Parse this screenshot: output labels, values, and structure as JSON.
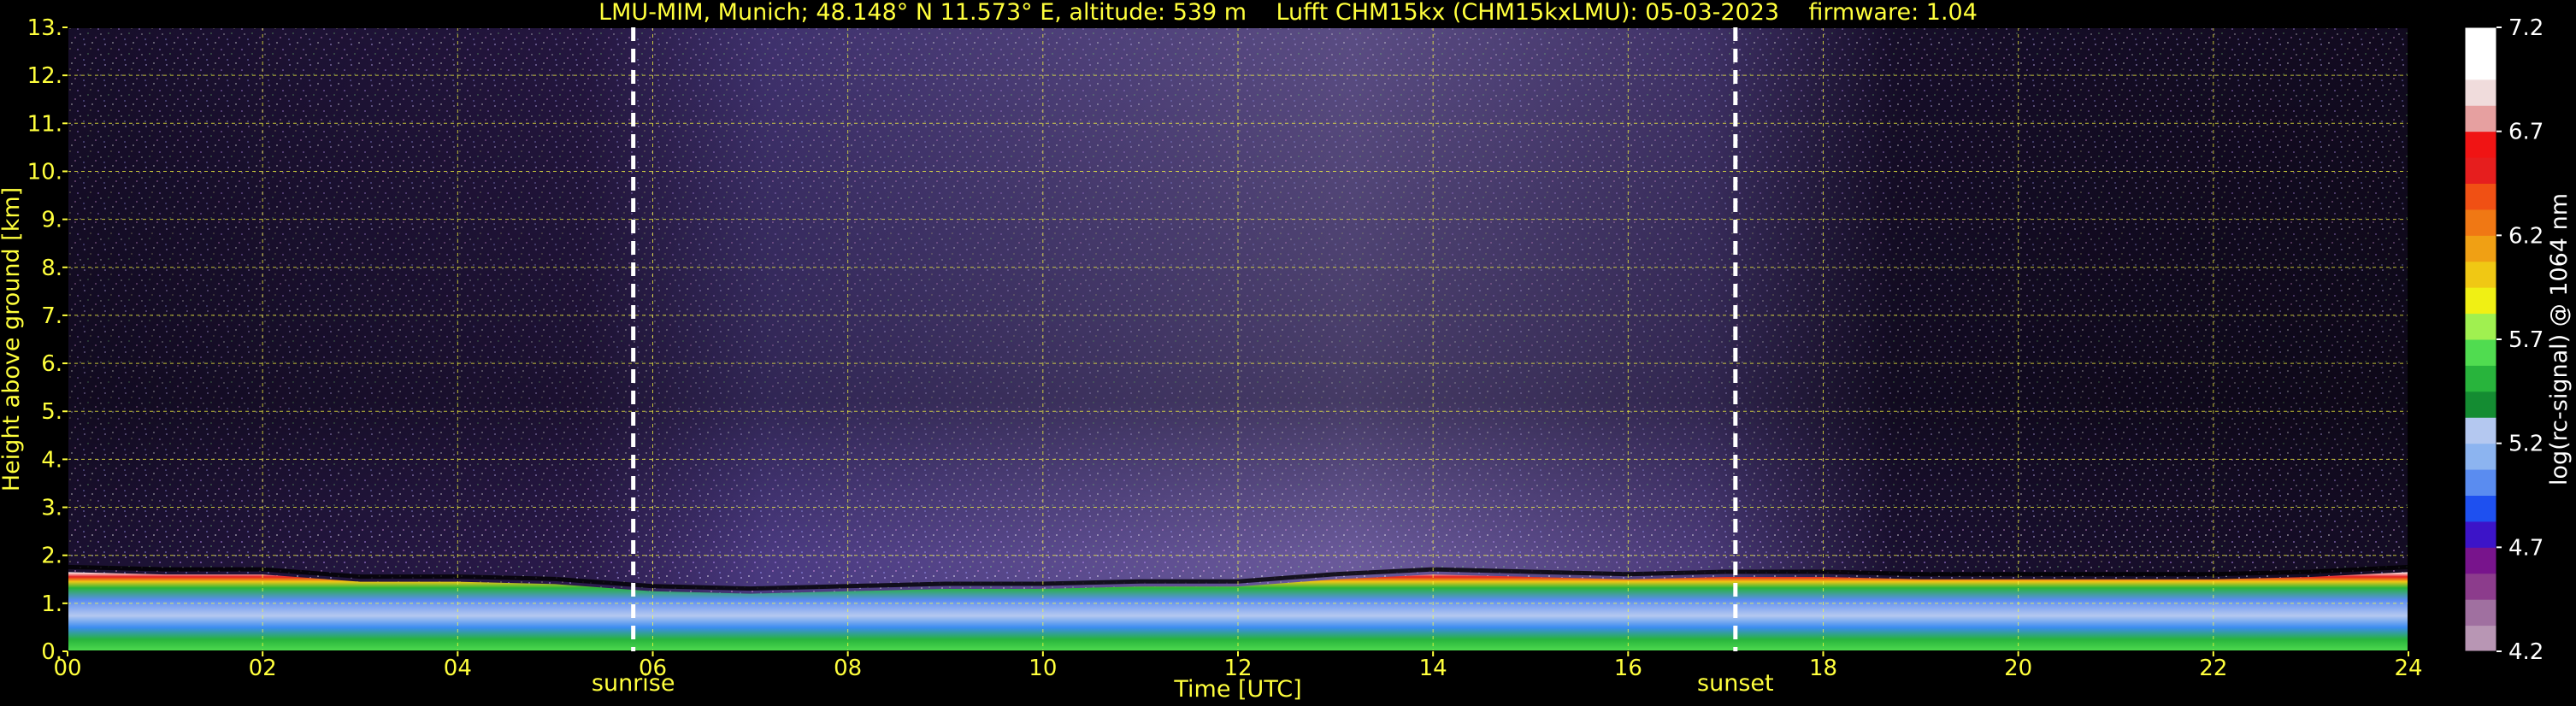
{
  "chart_data": {
    "type": "heatmap",
    "title": "LMU-MIM, Munich; 48.148° N 11.573° E, altitude: 539 m    Lufft CHM15kx (CHM15kxLMU): 05-03-2023    firmware: 1.04",
    "xlabel": "Time [UTC]",
    "ylabel": "Height above ground [km]",
    "xlim": [
      0,
      24
    ],
    "ylim": [
      0,
      13
    ],
    "x_ticks": [
      "00",
      "02",
      "04",
      "06",
      "08",
      "10",
      "12",
      "14",
      "16",
      "18",
      "20",
      "22",
      "24"
    ],
    "y_ticks": [
      "0.",
      "1.",
      "2.",
      "3.",
      "4.",
      "5.",
      "6.",
      "7.",
      "8.",
      "9.",
      "10.",
      "11.",
      "12.",
      "13."
    ],
    "grid": true,
    "events": [
      {
        "label": "sunrise",
        "time": 5.8
      },
      {
        "label": "sunset",
        "time": 17.1
      }
    ],
    "colorbar": {
      "label": "log(rc-signal) @ 1064 nm",
      "range": [
        4.2,
        7.2
      ],
      "ticks": [
        "4.2",
        "4.7",
        "5.2",
        "5.7",
        "6.2",
        "6.7",
        "7.2"
      ],
      "colors": [
        "#b896b4",
        "#a070a0",
        "#8c3c8c",
        "#78148c",
        "#3c14c8",
        "#1e50f0",
        "#5a8cf0",
        "#8cb4f0",
        "#b4c8f0",
        "#148c32",
        "#28b43c",
        "#50dc50",
        "#a0f050",
        "#f0f014",
        "#f0c814",
        "#f0a014",
        "#f07814",
        "#f05014",
        "#e61e1e",
        "#f01414",
        "#e6a0a0",
        "#f0dcdc",
        "#ffffff",
        "#ffffff"
      ]
    },
    "layers": [
      {
        "name": "boundary_layer_top_km",
        "x": [
          0,
          1,
          2,
          3,
          4,
          5,
          6,
          7,
          8,
          9,
          10,
          11,
          12,
          13,
          14,
          15,
          16,
          17,
          18,
          19,
          20,
          21,
          22,
          23,
          24
        ],
        "y": [
          1.65,
          1.6,
          1.6,
          1.45,
          1.45,
          1.4,
          1.25,
          1.2,
          1.25,
          1.3,
          1.3,
          1.35,
          1.35,
          1.5,
          1.6,
          1.55,
          1.5,
          1.55,
          1.55,
          1.5,
          1.5,
          1.5,
          1.5,
          1.55,
          1.65
        ]
      }
    ]
  }
}
